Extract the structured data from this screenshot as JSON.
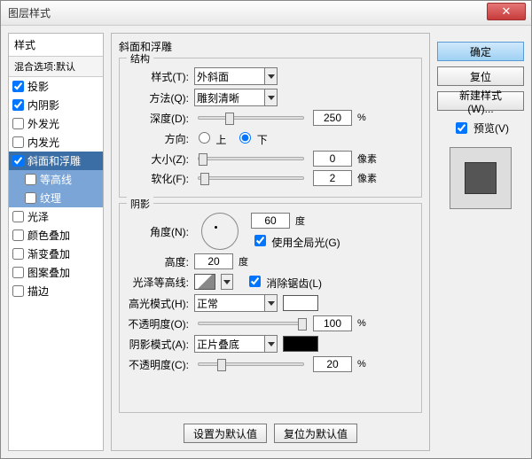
{
  "window": {
    "title": "图层样式"
  },
  "left": {
    "header": "样式",
    "sub": "混合选项:默认",
    "items": [
      {
        "label": "投影",
        "checked": true
      },
      {
        "label": "内阴影",
        "checked": true
      },
      {
        "label": "外发光",
        "checked": false
      },
      {
        "label": "内发光",
        "checked": false
      },
      {
        "label": "斜面和浮雕",
        "checked": true,
        "selected": true
      },
      {
        "label": "等高线",
        "checked": false,
        "sub": true
      },
      {
        "label": "纹理",
        "checked": false,
        "sub": true
      },
      {
        "label": "光泽",
        "checked": false
      },
      {
        "label": "颜色叠加",
        "checked": false
      },
      {
        "label": "渐变叠加",
        "checked": false
      },
      {
        "label": "图案叠加",
        "checked": false
      },
      {
        "label": "描边",
        "checked": false
      }
    ]
  },
  "center": {
    "title": "斜面和浮雕",
    "struct": {
      "title": "结构",
      "style_label": "样式(T):",
      "style_value": "外斜面",
      "method_label": "方法(Q):",
      "method_value": "雕刻清晰",
      "depth_label": "深度(D):",
      "depth_value": "250",
      "depth_unit": "%",
      "dir_label": "方向:",
      "dir_up": "上",
      "dir_down": "下",
      "size_label": "大小(Z):",
      "size_value": "0",
      "size_unit": "像素",
      "soft_label": "软化(F):",
      "soft_value": "2",
      "soft_unit": "像素"
    },
    "shade": {
      "title": "阴影",
      "angle_label": "角度(N):",
      "angle_value": "60",
      "angle_unit": "度",
      "global_label": "使用全局光(G)",
      "alt_label": "高度:",
      "alt_value": "20",
      "alt_unit": "度",
      "gloss_label": "光泽等高线:",
      "antialias_label": "消除锯齿(L)",
      "hmode_label": "高光模式(H):",
      "hmode_value": "正常",
      "hop_label": "不透明度(O):",
      "hop_value": "100",
      "hop_unit": "%",
      "smode_label": "阴影模式(A):",
      "smode_value": "正片叠底",
      "sop_label": "不透明度(C):",
      "sop_value": "20",
      "sop_unit": "%"
    },
    "btn_default": "设置为默认值",
    "btn_reset": "复位为默认值"
  },
  "right": {
    "ok": "确定",
    "cancel": "复位",
    "newstyle": "新建样式(W)...",
    "preview": "预览(V)"
  }
}
